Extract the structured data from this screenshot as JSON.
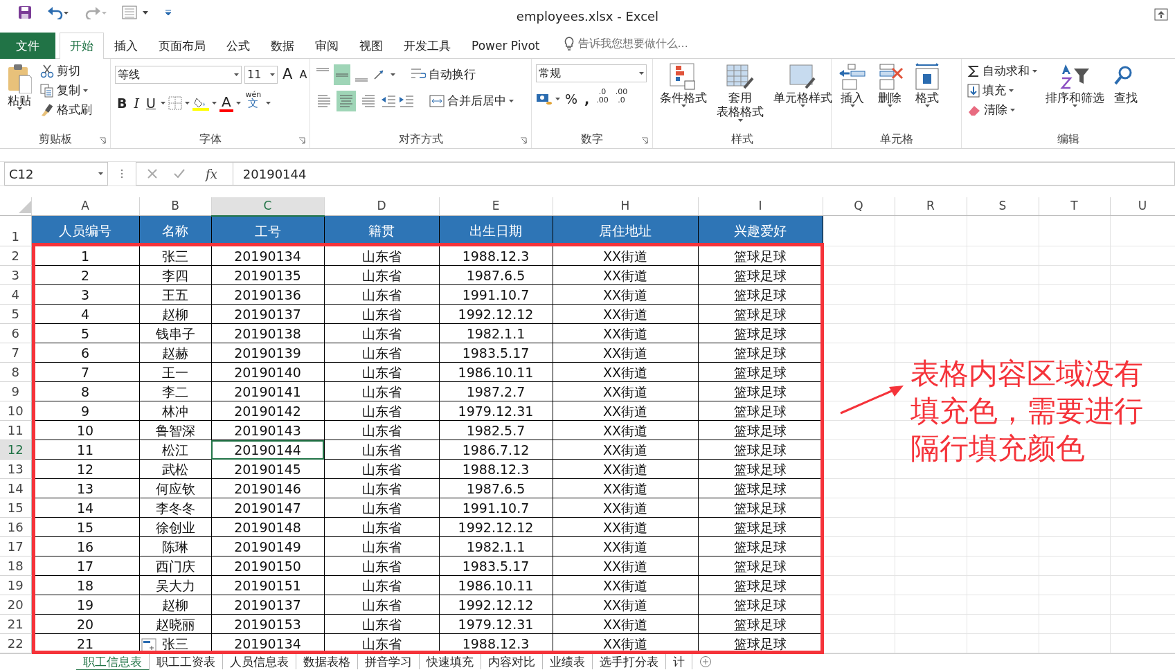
{
  "window": {
    "title": "employees.xlsx - Excel"
  },
  "tabs": [
    {
      "label": "文件",
      "kind": "file",
      "selected": false
    },
    {
      "label": "开始",
      "kind": "tab",
      "selected": true
    },
    {
      "label": "插入",
      "kind": "tab",
      "selected": false
    },
    {
      "label": "页面布局",
      "kind": "tab",
      "selected": false
    },
    {
      "label": "公式",
      "kind": "tab",
      "selected": false
    },
    {
      "label": "数据",
      "kind": "tab",
      "selected": false
    },
    {
      "label": "审阅",
      "kind": "tab",
      "selected": false
    },
    {
      "label": "视图",
      "kind": "tab",
      "selected": false
    },
    {
      "label": "开发工具",
      "kind": "tab",
      "selected": false
    },
    {
      "label": "Power Pivot",
      "kind": "tab",
      "selected": false
    }
  ],
  "tell_me": {
    "placeholder": "告诉我您想要做什么..."
  },
  "ribbon": {
    "clipboard": {
      "label": "剪贴板",
      "paste": "粘贴",
      "cut": "剪切",
      "copy": "复制",
      "format_painter": "格式刷"
    },
    "font": {
      "label": "字体",
      "font_name": "等线",
      "font_size": "11",
      "grow": "A",
      "shrink": "A",
      "bold": "B",
      "italic": "I",
      "underline": "U",
      "font_color": "A",
      "phonetic_top": "wén",
      "phonetic_bottom": "文"
    },
    "alignment": {
      "label": "对齐方式",
      "wrap": "自动换行",
      "merge": "合并后居中",
      "vertical": [
        {
          "selected": false
        },
        {
          "selected": true
        },
        {
          "selected": false
        }
      ],
      "horizontal": [
        {
          "selected": false
        },
        {
          "selected": true
        },
        {
          "selected": false
        }
      ]
    },
    "number": {
      "label": "数字",
      "format": "常规",
      "percent": "%",
      "comma": ",",
      "inc_top": ".0",
      "inc_bottom": ".00",
      "dec_top": ".00",
      "dec_bottom": ".0"
    },
    "styles": {
      "label": "样式",
      "buttons": [
        {
          "label": "条件格式",
          "kind": "conditional"
        },
        {
          "label": "套用",
          "label2": "表格格式",
          "kind": "table"
        },
        {
          "label": "单元格样式",
          "kind": "cellstyle"
        }
      ]
    },
    "cells": {
      "label": "单元格",
      "buttons": [
        {
          "label": "插入",
          "kind": "insert"
        },
        {
          "label": "删除",
          "kind": "delete"
        },
        {
          "label": "格式",
          "kind": "format"
        }
      ]
    },
    "editing": {
      "label": "编辑",
      "autosum": "自动求和",
      "fill": "填充",
      "clear": "清除",
      "sort": "排序和筛选",
      "find": "查找"
    }
  },
  "formula_bar": {
    "name_box": "C12",
    "fx": "fx",
    "value": "20190144"
  },
  "columns": [
    {
      "label": "A",
      "selected": false
    },
    {
      "label": "B",
      "selected": false
    },
    {
      "label": "C",
      "selected": true
    },
    {
      "label": "D",
      "selected": false
    },
    {
      "label": "E",
      "selected": false
    },
    {
      "label": "H",
      "selected": false
    },
    {
      "label": "I",
      "selected": false
    },
    {
      "label": "Q",
      "selected": false
    },
    {
      "label": "R",
      "selected": false
    },
    {
      "label": "S",
      "selected": false
    },
    {
      "label": "T",
      "selected": false
    },
    {
      "label": "U",
      "selected": false
    }
  ],
  "header_row": {
    "number": "1",
    "selected": false,
    "cells": [
      "人员编号",
      "名称",
      "工号",
      "籍贯",
      "出生日期",
      "居住地址",
      "兴趣爱好"
    ]
  },
  "rows": [
    {
      "number": "2",
      "selected": false,
      "cells": [
        "1",
        "张三",
        "20190134",
        "山东省",
        "1988.12.3",
        "XX街道",
        "篮球足球"
      ]
    },
    {
      "number": "3",
      "selected": false,
      "cells": [
        "2",
        "李四",
        "20190135",
        "山东省",
        "1987.6.5",
        "XX街道",
        "篮球足球"
      ]
    },
    {
      "number": "4",
      "selected": false,
      "cells": [
        "3",
        "王五",
        "20190136",
        "山东省",
        "1991.10.7",
        "XX街道",
        "篮球足球"
      ]
    },
    {
      "number": "5",
      "selected": false,
      "cells": [
        "4",
        "赵柳",
        "20190137",
        "山东省",
        "1992.12.12",
        "XX街道",
        "篮球足球"
      ]
    },
    {
      "number": "6",
      "selected": false,
      "cells": [
        "5",
        "钱串子",
        "20190138",
        "山东省",
        "1982.1.1",
        "XX街道",
        "篮球足球"
      ]
    },
    {
      "number": "7",
      "selected": false,
      "cells": [
        "6",
        "赵赫",
        "20190139",
        "山东省",
        "1983.5.17",
        "XX街道",
        "篮球足球"
      ]
    },
    {
      "number": "8",
      "selected": false,
      "cells": [
        "7",
        "王一",
        "20190140",
        "山东省",
        "1986.10.11",
        "XX街道",
        "篮球足球"
      ]
    },
    {
      "number": "9",
      "selected": false,
      "cells": [
        "8",
        "李二",
        "20190141",
        "山东省",
        "1987.2.7",
        "XX街道",
        "篮球足球"
      ]
    },
    {
      "number": "10",
      "selected": false,
      "cells": [
        "9",
        "林冲",
        "20190142",
        "山东省",
        "1979.12.31",
        "XX街道",
        "篮球足球"
      ]
    },
    {
      "number": "11",
      "selected": false,
      "cells": [
        "10",
        "鲁智深",
        "20190143",
        "山东省",
        "1982.5.7",
        "XX街道",
        "篮球足球"
      ]
    },
    {
      "number": "12",
      "selected": true,
      "cells": [
        "11",
        "松江",
        "20190144",
        "山东省",
        "1986.7.12",
        "XX街道",
        "篮球足球"
      ]
    },
    {
      "number": "13",
      "selected": false,
      "cells": [
        "12",
        "武松",
        "20190145",
        "山东省",
        "1988.12.3",
        "XX街道",
        "篮球足球"
      ]
    },
    {
      "number": "14",
      "selected": false,
      "cells": [
        "13",
        "何应钦",
        "20190146",
        "山东省",
        "1987.6.5",
        "XX街道",
        "篮球足球"
      ]
    },
    {
      "number": "15",
      "selected": false,
      "cells": [
        "14",
        "李冬冬",
        "20190147",
        "山东省",
        "1991.10.7",
        "XX街道",
        "篮球足球"
      ]
    },
    {
      "number": "16",
      "selected": false,
      "cells": [
        "15",
        "徐创业",
        "20190148",
        "山东省",
        "1992.12.12",
        "XX街道",
        "篮球足球"
      ]
    },
    {
      "number": "17",
      "selected": false,
      "cells": [
        "16",
        "陈琳",
        "20190149",
        "山东省",
        "1982.1.1",
        "XX街道",
        "篮球足球"
      ]
    },
    {
      "number": "18",
      "selected": false,
      "cells": [
        "17",
        "西门庆",
        "20190150",
        "山东省",
        "1983.5.17",
        "XX街道",
        "篮球足球"
      ]
    },
    {
      "number": "19",
      "selected": false,
      "cells": [
        "18",
        "吴大力",
        "20190151",
        "山东省",
        "1986.10.11",
        "XX街道",
        "篮球足球"
      ]
    },
    {
      "number": "20",
      "selected": false,
      "cells": [
        "19",
        "赵柳",
        "20190137",
        "山东省",
        "1992.12.12",
        "XX街道",
        "篮球足球"
      ]
    },
    {
      "number": "21",
      "selected": false,
      "cells": [
        "20",
        "赵晓丽",
        "20190153",
        "山东省",
        "1979.12.31",
        "XX街道",
        "篮球足球"
      ]
    },
    {
      "number": "22",
      "selected": false,
      "cells": [
        "21",
        "张三",
        "20190134",
        "山东省",
        "1988.12.3",
        "XX街道",
        "篮球足球"
      ]
    }
  ],
  "annotation": {
    "lines": [
      "表格内容区域没有",
      "填充色，需要进行",
      "隔行填充颜色"
    ]
  },
  "sheet_tabs": [
    {
      "label": "职工信息表",
      "selected": true
    },
    {
      "label": "职工工资表",
      "selected": false
    },
    {
      "label": "人员信息表",
      "selected": false
    },
    {
      "label": "数据表格",
      "selected": false
    },
    {
      "label": "拼音学习",
      "selected": false
    },
    {
      "label": "快速填充",
      "selected": false
    },
    {
      "label": "内容对比",
      "selected": false
    },
    {
      "label": "业绩表",
      "selected": false
    },
    {
      "label": "选手打分表",
      "selected": false
    },
    {
      "label": "计",
      "selected": false
    }
  ]
}
